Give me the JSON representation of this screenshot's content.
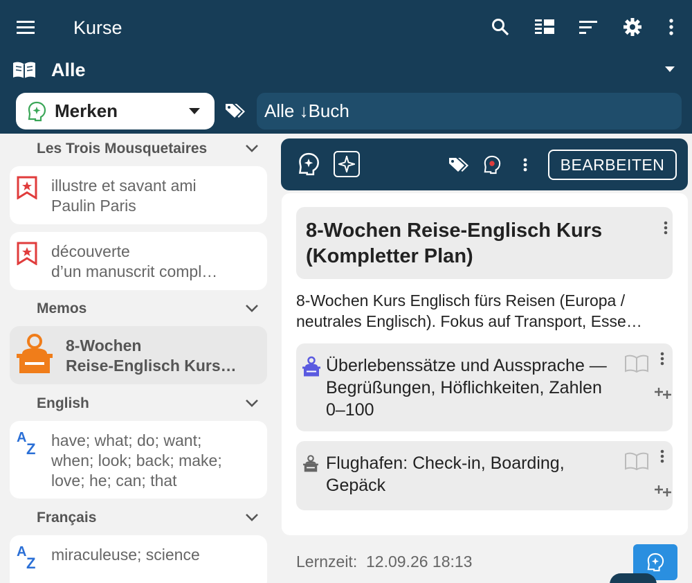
{
  "header": {
    "title": "Kurse",
    "collection_label": "Alle",
    "mode_label": "Merken",
    "filter_text": "Alle ↓Buch"
  },
  "left": {
    "sections": [
      {
        "title": "Les Trois Mousquetaires"
      },
      {
        "title": "Memos"
      },
      {
        "title": "English"
      },
      {
        "title": "Français"
      }
    ],
    "cards": [
      {
        "text": "illustre et savant ami\nPaulin Paris",
        "icon": "bookmark-icon"
      },
      {
        "text": "découverte\nd’un manuscrit compl…",
        "icon": "bookmark-icon"
      },
      {
        "text": "8-Wochen\nReise-Englisch Kurs…",
        "icon": "teacher-icon"
      },
      {
        "text": "have; what; do; want;\nwhen; look; back; make;\nlove; he; can; that",
        "icon": "az-icon"
      },
      {
        "text": "miraculeuse; science",
        "icon": "az-icon"
      }
    ]
  },
  "right": {
    "edit_label": "BEARBEITEN",
    "course_title": "8-Wochen Reise-Englisch Kurs (Kompletter Plan)",
    "description": "8-Wochen Kurs Englisch fürs Reisen (Europa / neutrales Englisch). Fokus auf Transport, Esse…",
    "lessons": [
      {
        "text": "Überlebenssätze und Aussprache — Begrüßungen, Höflichkeiten, Zahlen 0–100"
      },
      {
        "text": "Flughafen: Check-in, Boarding, Gepäck"
      }
    ],
    "lernzeit_label": "Lernzeit:",
    "lernzeit_value": "12.09.26 18:13"
  },
  "colors": {
    "header_bg": "#173d57",
    "accent_blue": "#2a8fe0",
    "bookmark_red": "#e03c3c",
    "teacher_orange": "#f07d1a",
    "merken_green": "#3aa657"
  }
}
